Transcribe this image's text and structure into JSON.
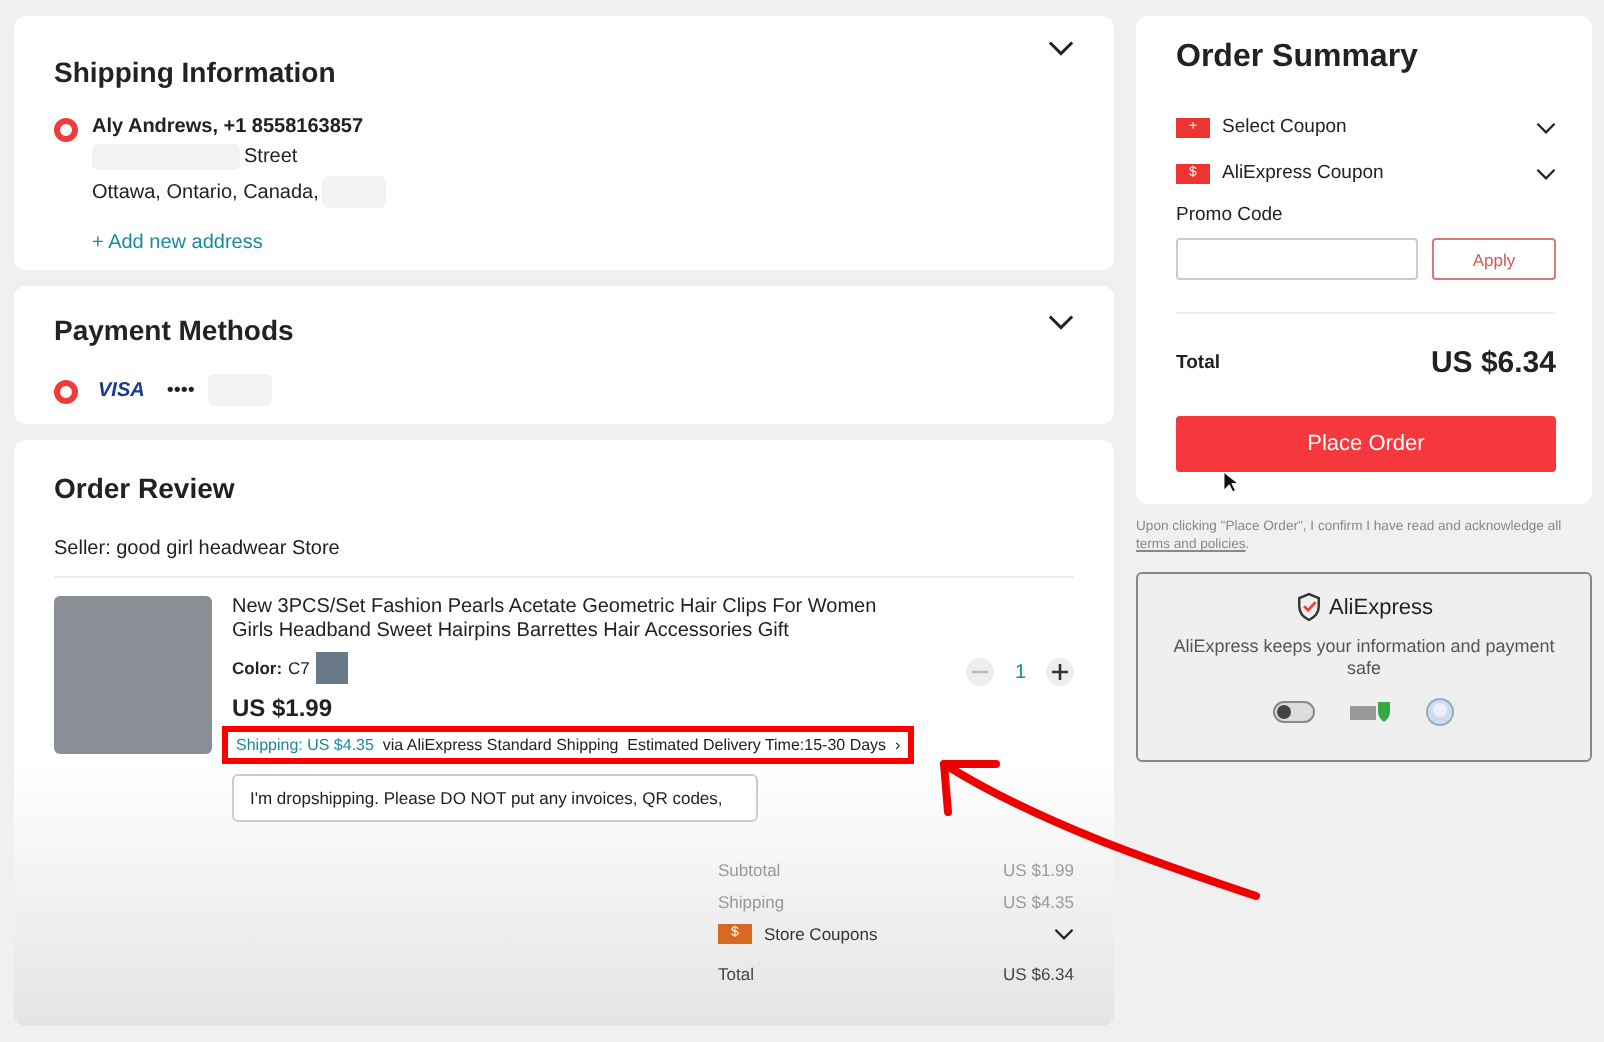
{
  "shipping": {
    "title": "Shipping Information",
    "address": {
      "selected": true,
      "name": "Aly Andrews, +1 8558163857",
      "street": "Street",
      "city": "Ottawa, Ontario, Canada,"
    },
    "add_link": "+ Add new address"
  },
  "payment": {
    "title": "Payment Methods",
    "method": {
      "selected": true,
      "brand": "VISA",
      "masked": "••••"
    }
  },
  "order_review": {
    "title": "Order Review",
    "seller": "Seller: good girl headwear Store",
    "item": {
      "title": "New 3PCS/Set Fashion Pearls Acetate Geometric Hair Clips For Women Girls Headband Sweet Hairpins Barrettes Hair Accessories Gift",
      "color_label": "Color:",
      "color_value": "C7",
      "price": "US $1.99",
      "quantity": "1",
      "decrease_disabled": true,
      "shipping_cost": "Shipping: US $4.35",
      "shipping_method": "via AliExpress Standard Shipping",
      "delivery": "Estimated Delivery Time:15-30 Days",
      "chevron": "›",
      "highlighted": true
    },
    "note": "I'm dropshipping. Please DO NOT put any invoices, QR codes,",
    "totals": [
      {
        "kind": "line",
        "label": "Subtotal",
        "value": "US $1.99"
      },
      {
        "kind": "line",
        "label": "Shipping",
        "value": "US $4.35"
      },
      {
        "kind": "coupon",
        "label": "Store Coupons",
        "icon_text": "$"
      },
      {
        "kind": "total",
        "label": "Total",
        "value": "US $6.34"
      }
    ]
  },
  "order_summary": {
    "title": "Order Summary",
    "coupons": [
      {
        "label": "Select Coupon",
        "icon_text": "+"
      },
      {
        "label": "AliExpress Coupon",
        "icon_text": "$"
      }
    ],
    "promo_label": "Promo Code",
    "apply": "Apply",
    "total_label": "Total",
    "total_value": "US $6.34",
    "place_order": "Place Order"
  },
  "legal": {
    "text": "Upon clicking \"Place Order\", I confirm I have read and acknowledge all",
    "link": "terms and policies",
    "end": "."
  },
  "security": {
    "brand": "AliExpress",
    "text": "AliExpress keeps your information and payment safe"
  }
}
